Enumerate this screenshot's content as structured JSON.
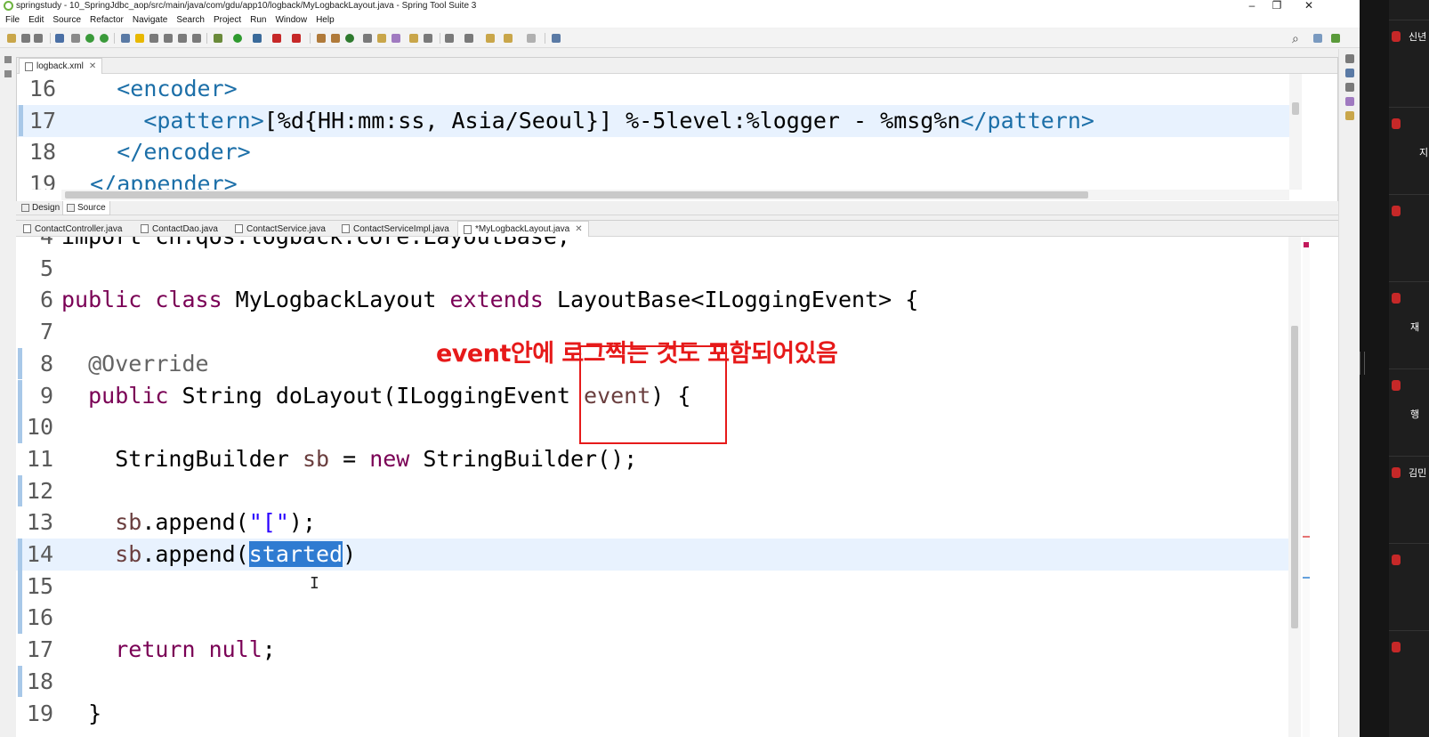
{
  "window": {
    "title": "springstudy - 10_SpringJdbc_aop/src/main/java/com/gdu/app10/logback/MyLogbackLayout.java - Spring Tool Suite 3",
    "minimize": "–",
    "restore": "❐",
    "close": "✕"
  },
  "menu": [
    "File",
    "Edit",
    "Source",
    "Refactor",
    "Navigate",
    "Search",
    "Project",
    "Run",
    "Window",
    "Help"
  ],
  "xml_editor": {
    "tab": "logback.xml",
    "lines": [
      {
        "n": "16",
        "parts": [
          {
            "t": "    ",
            "c": ""
          },
          {
            "t": "<encoder>",
            "c": "tag"
          }
        ]
      },
      {
        "n": "17",
        "parts": [
          {
            "t": "      ",
            "c": ""
          },
          {
            "t": "<pattern>",
            "c": "tag"
          },
          {
            "t": "[%d{HH:mm:ss, Asia/Seoul}] %-5level:%logger - %msg%n",
            "c": ""
          },
          {
            "t": "</pattern>",
            "c": "tag"
          }
        ]
      },
      {
        "n": "18",
        "parts": [
          {
            "t": "    ",
            "c": ""
          },
          {
            "t": "</encoder>",
            "c": "tag"
          }
        ]
      },
      {
        "n": "19",
        "parts": [
          {
            "t": "  ",
            "c": ""
          },
          {
            "t": "</appender>",
            "c": "tag"
          }
        ]
      }
    ],
    "design_tab": "Design",
    "source_tab": "Source"
  },
  "java_editor": {
    "tabs": [
      "ContactController.java",
      "ContactDao.java",
      "ContactService.java",
      "ContactServiceImpl.java",
      "*MyLogbackLayout.java"
    ],
    "active_tab": "*MyLogbackLayout.java",
    "lines": [
      {
        "n": "4",
        "parts": [
          {
            "t": "import ch.qos.logback.core.LayoutBase;",
            "c": ""
          }
        ]
      },
      {
        "n": "5",
        "parts": []
      },
      {
        "n": "6",
        "parts": [
          {
            "t": "public class",
            "c": "kw"
          },
          {
            "t": " MyLogbackLayout ",
            "c": ""
          },
          {
            "t": "extends",
            "c": "kw"
          },
          {
            "t": " LayoutBase<ILoggingEvent> {",
            "c": ""
          }
        ]
      },
      {
        "n": "7",
        "parts": []
      },
      {
        "n": "8",
        "parts": [
          {
            "t": "  @Override",
            "c": "ann"
          }
        ]
      },
      {
        "n": "9",
        "parts": [
          {
            "t": "  ",
            "c": ""
          },
          {
            "t": "public",
            "c": "kw"
          },
          {
            "t": " String doLayout(ILoggingEvent ",
            "c": ""
          },
          {
            "t": "event",
            "c": "var"
          },
          {
            "t": ") {",
            "c": ""
          }
        ]
      },
      {
        "n": "10",
        "parts": []
      },
      {
        "n": "11",
        "parts": [
          {
            "t": "    StringBuilder ",
            "c": ""
          },
          {
            "t": "sb",
            "c": "var"
          },
          {
            "t": " = ",
            "c": ""
          },
          {
            "t": "new",
            "c": "kw"
          },
          {
            "t": " StringBuilder();",
            "c": ""
          }
        ]
      },
      {
        "n": "12",
        "parts": []
      },
      {
        "n": "13",
        "parts": [
          {
            "t": "    ",
            "c": ""
          },
          {
            "t": "sb",
            "c": "var"
          },
          {
            "t": ".append(",
            "c": ""
          },
          {
            "t": "\"[\"",
            "c": "str"
          },
          {
            "t": ");",
            "c": ""
          }
        ]
      },
      {
        "n": "14",
        "parts": [
          {
            "t": "    ",
            "c": ""
          },
          {
            "t": "sb",
            "c": "var"
          },
          {
            "t": ".append(",
            "c": ""
          },
          {
            "t": "started",
            "c": "sel"
          },
          {
            "t": ")",
            "c": ""
          }
        ]
      },
      {
        "n": "15",
        "parts": []
      },
      {
        "n": "16",
        "parts": []
      },
      {
        "n": "17",
        "parts": [
          {
            "t": "    ",
            "c": ""
          },
          {
            "t": "return null",
            "c": "kw"
          },
          {
            "t": ";",
            "c": ""
          }
        ]
      },
      {
        "n": "18",
        "parts": []
      },
      {
        "n": "19",
        "parts": [
          {
            "t": "  }",
            "c": ""
          }
        ]
      }
    ]
  },
  "annotation": {
    "text": "event안에 로그찍는 것도 포함되어있음"
  },
  "caret_glyph": "I",
  "side_panel": {
    "participants": [
      "신년",
      "지",
      "",
      "재",
      "행",
      "김민",
      "",
      ""
    ]
  },
  "colors": {
    "annotation": "#e61a1a",
    "keyword": "#7a0055",
    "tag": "#1c6fa8",
    "string": "#2a00ff",
    "selection": "#2f7bd1"
  }
}
